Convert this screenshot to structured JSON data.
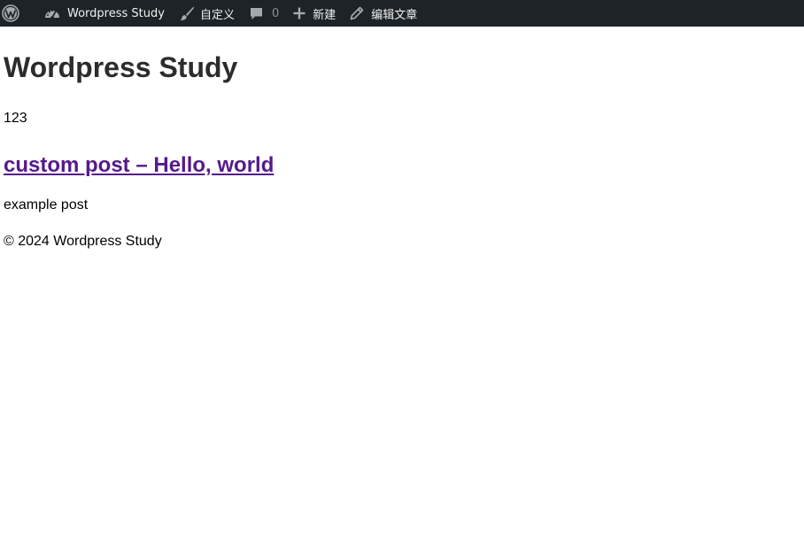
{
  "admin_bar": {
    "wp_logo_icon": "wordpress-logo-icon",
    "site_name": "Wordpress Study",
    "site_icon": "dashboard-gauge-icon",
    "customize_label": "自定义",
    "customize_icon": "paintbrush-icon",
    "comments_count": "0",
    "comments_icon": "comment-bubble-icon",
    "new_label": "新建",
    "new_icon": "plus-icon",
    "edit_label": "编辑文章",
    "edit_icon": "pencil-icon",
    "background_color": "#1d2327",
    "text_color": "#f0f0f1"
  },
  "page": {
    "site_title": "Wordpress Study",
    "site_description": "123",
    "post": {
      "title": "custom post – Hello, world",
      "excerpt": "example post",
      "link_color": "#551a8b"
    },
    "footer_text": "© 2024 Wordpress Study"
  }
}
